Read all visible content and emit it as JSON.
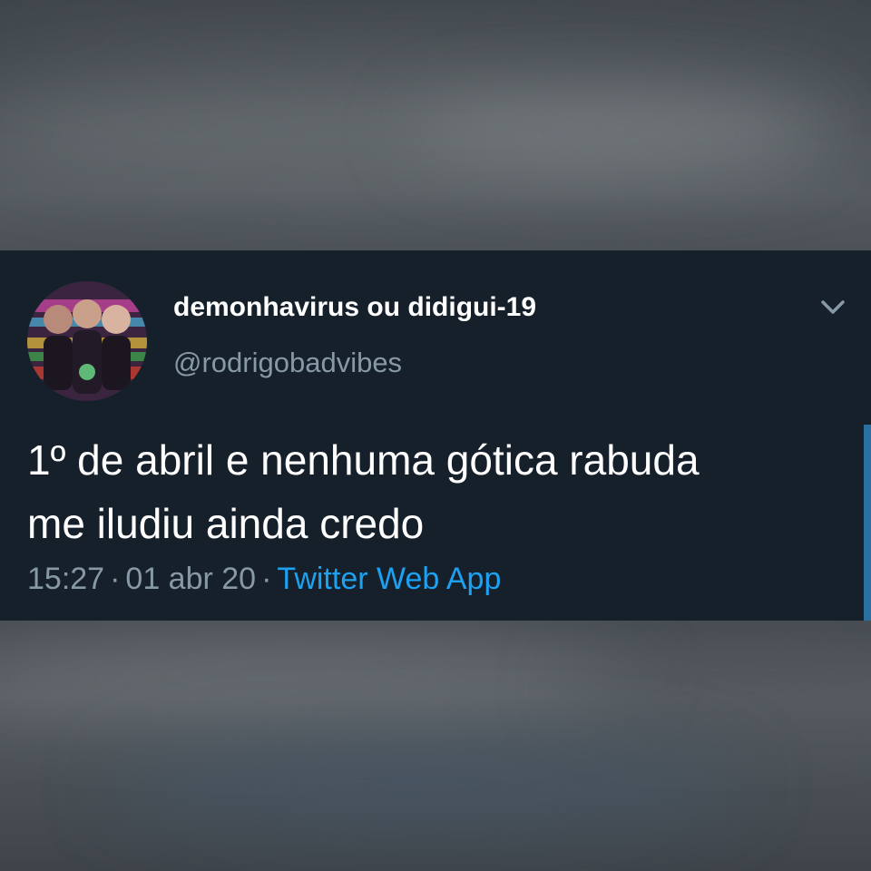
{
  "tweet": {
    "display_name": "demonhavirus ou didigui-19",
    "handle": "@rodrigobadvibes",
    "text_lines": [
      "1º de abril e nenhuma gótica rabuda",
      "me iludiu ainda credo"
    ],
    "time": "15:27",
    "separator": "·",
    "date": "01 abr 20",
    "source": "Twitter Web App",
    "avatar_icon": "avatar-photo-icon",
    "menu_icon": "chevron-down-icon"
  },
  "colors": {
    "card_background": "#15202b",
    "text_primary": "#ffffff",
    "text_secondary": "#8899a6",
    "link": "#1da1f2",
    "accent_bar": "#2a6f9f"
  }
}
